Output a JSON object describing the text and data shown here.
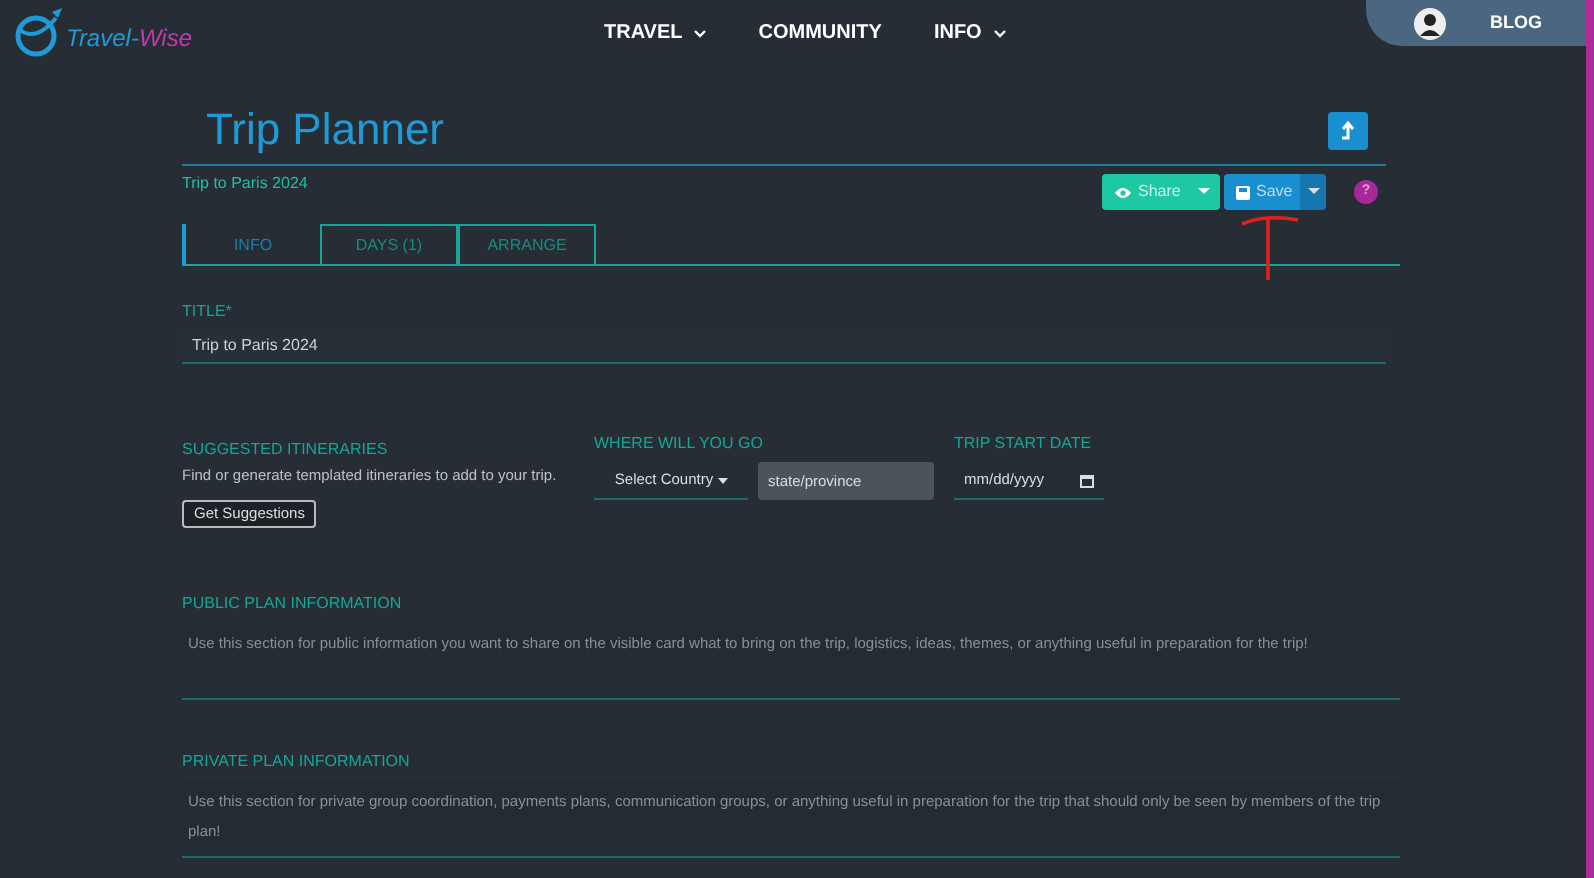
{
  "logo": {
    "part_1": "Travel-",
    "part_2": "Wise"
  },
  "nav": [
    {
      "label": "TRAVEL",
      "dropdown": true
    },
    {
      "label": "COMMUNITY",
      "dropdown": false
    },
    {
      "label": "INFO",
      "dropdown": true
    }
  ],
  "blog": {
    "label": "BLOG"
  },
  "page_title": "Trip Planner",
  "trip_name": "Trip to Paris 2024",
  "actions": {
    "share": "Share",
    "save": "Save",
    "help": "?"
  },
  "tabs": [
    {
      "label": "INFO",
      "selected": true
    },
    {
      "label": "DAYS (1)",
      "selected": false
    },
    {
      "label": "ARRANGE",
      "selected": false
    }
  ],
  "title_field": {
    "label": "TITLE*",
    "value": "Trip to Paris 2024"
  },
  "suggested": {
    "heading": "SUGGESTED ITINERARIES",
    "text": "Find or generate templated itineraries to add to your trip.",
    "button": "Get Suggestions"
  },
  "where": {
    "label": "WHERE WILL YOU GO",
    "country": "Select Country",
    "state_placeholder": "state/province"
  },
  "start_date": {
    "label": "TRIP START DATE",
    "placeholder": "mm/dd/yyyy"
  },
  "sections": [
    {
      "label": "PUBLIC PLAN INFORMATION",
      "placeholder": "Use this section for public information you want to share on the visible card what to bring on the trip, logistics, ideas, themes, or anything useful in preparation for the trip!"
    },
    {
      "label": "PRIVATE PLAN INFORMATION",
      "placeholder": "Use this section for private group coordination, payments plans, communication groups, or anything useful in preparation for the trip that should only be seen by members of the trip plan!"
    }
  ]
}
